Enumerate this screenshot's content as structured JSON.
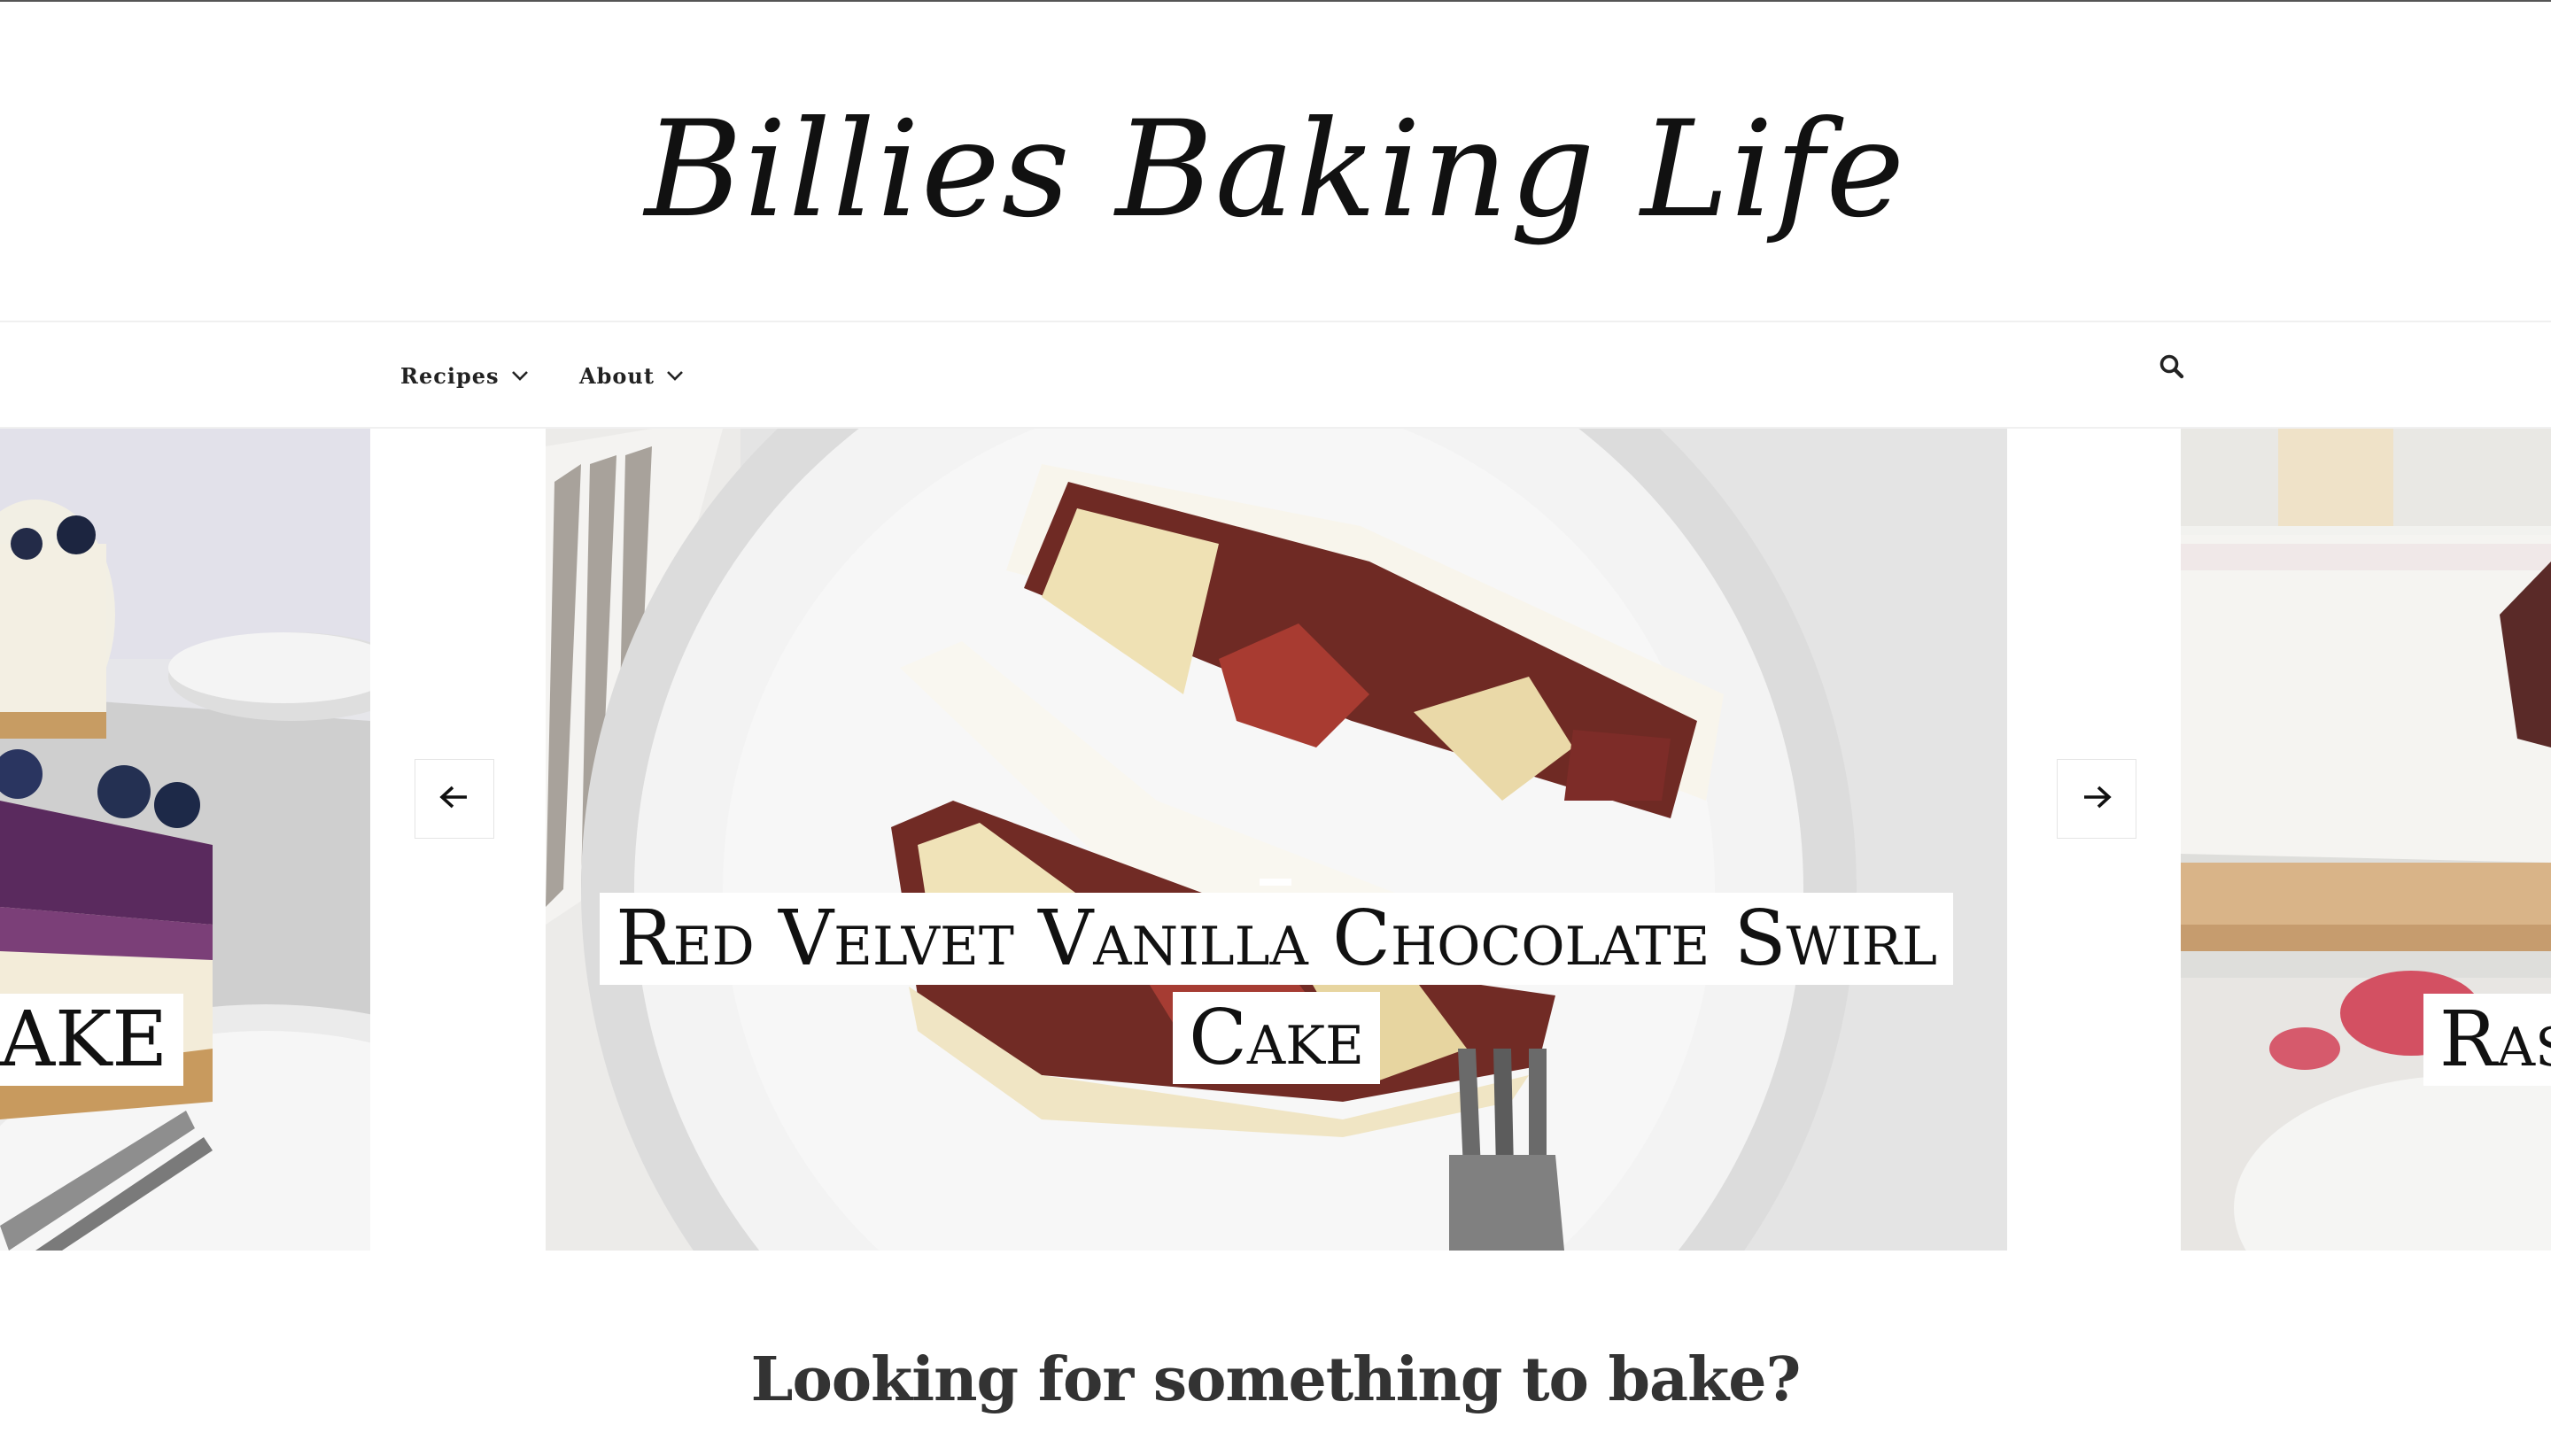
{
  "header": {
    "logo_text": "Billies Baking Life"
  },
  "nav": {
    "items": [
      {
        "label": "Recipes",
        "icon": "chevron-down-icon"
      },
      {
        "label": "About",
        "icon": "chevron-down-icon"
      }
    ],
    "search_icon": "search-icon"
  },
  "slider": {
    "prev_icon": "arrow-left-icon",
    "next_icon": "arrow-right-icon",
    "slides": [
      {
        "title_visible": "AKE",
        "image": "blueberry cheesecake slice with fork"
      },
      {
        "title_line_1": "Red Velvet Vanilla Chocolate Swirl",
        "title_line_2": "Cake",
        "image": "marbled red velvet cake slice on white plate with fork"
      },
      {
        "title_visible": "Ras",
        "image": "raspberry dessert on wooden board"
      }
    ]
  },
  "section": {
    "heading": "Looking for something to bake?"
  }
}
